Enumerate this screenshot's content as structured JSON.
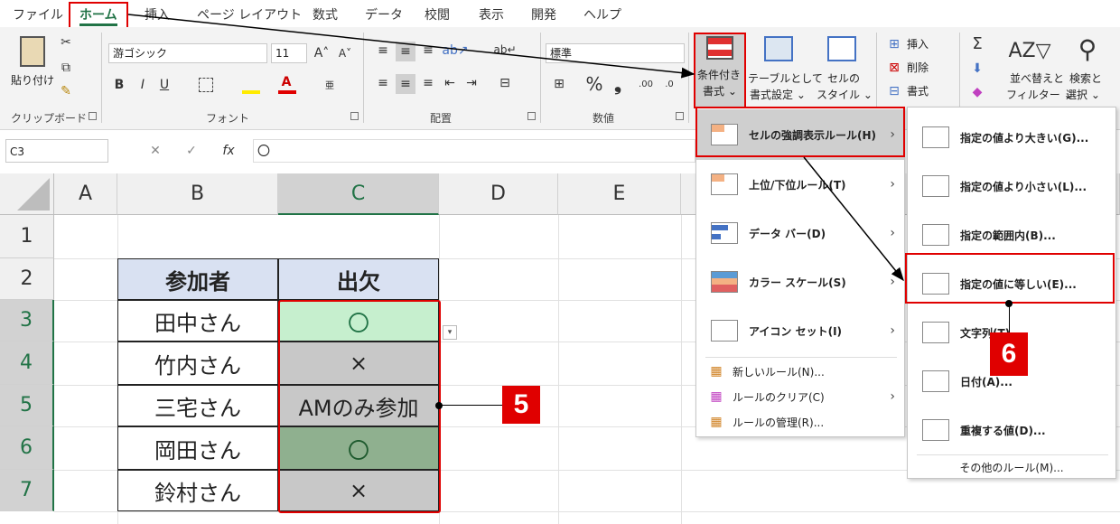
{
  "tabs": [
    "ファイル",
    "ホーム",
    "挿入",
    "ページ レイアウト",
    "数式",
    "データ",
    "校閲",
    "表示",
    "開発",
    "ヘルプ"
  ],
  "clipboard": {
    "paste": "貼り付け",
    "label": "クリップボード"
  },
  "font": {
    "name": "游ゴシック",
    "size": "11",
    "label": "フォント",
    "bold": "B",
    "italic": "I",
    "underline": "U"
  },
  "align": {
    "label": "配置"
  },
  "number": {
    "format": "標準",
    "label": "数値",
    "percent": "%",
    "comma": "❟"
  },
  "styles": {
    "cond": "条件付き",
    "cond2": "書式 ⌄",
    "table": "テーブルとして",
    "table2": "書式設定 ⌄",
    "cell": "セルの",
    "cell2": "スタイル ⌄"
  },
  "cells": {
    "insert": "挿入",
    "delete": "削除",
    "format": "書式"
  },
  "editing": {
    "sort": "並べ替えと",
    "sort2": "フィルター ⌄",
    "find": "検索と",
    "find2": "選択 ⌄"
  },
  "formula": {
    "namebox": "C3",
    "value": "〇",
    "fx": "fx"
  },
  "columns": [
    "A",
    "B",
    "C",
    "D",
    "E"
  ],
  "rows": [
    "1",
    "2",
    "3",
    "4",
    "5",
    "6",
    "7"
  ],
  "table": {
    "h1": "参加者",
    "h2": "出欠",
    "names": [
      "田中さん",
      "竹内さん",
      "三宅さん",
      "岡田さん",
      "鈴村さん"
    ],
    "vals": [
      "〇",
      "×",
      "AMのみ参加",
      "〇",
      "×"
    ]
  },
  "menu1": {
    "items": [
      "セルの強調表示ルール(H)",
      "上位/下位ルール(T)",
      "データ バー(D)",
      "カラー スケール(S)",
      "アイコン セット(I)"
    ],
    "small": [
      "新しいルール(N)...",
      "ルールのクリア(C)",
      "ルールの管理(R)..."
    ]
  },
  "menu2": {
    "items": [
      "指定の値より大きい(G)...",
      "指定の値より小さい(L)...",
      "指定の範囲内(B)...",
      "指定の値に等しい(E)...",
      "文字列(T)...",
      "日付(A)...",
      "重複する値(D)..."
    ],
    "other": "その他のルール(M)..."
  },
  "badges": {
    "five": "5",
    "six": "6"
  },
  "colors": {
    "accent": "#217346",
    "highlight": "#e00000",
    "header_fill": "#d9e1f2",
    "green_fill": "#c6efce",
    "dark_green_fill": "#8fb08f",
    "gray_fill": "#c8c8c8"
  }
}
